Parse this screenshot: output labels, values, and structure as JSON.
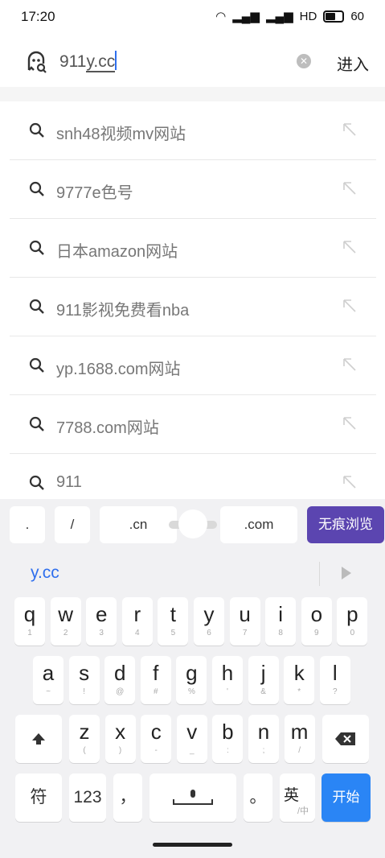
{
  "status_bar": {
    "time": "17:20",
    "network": "HD",
    "battery": "60"
  },
  "search": {
    "text_before": "911",
    "text_underlined": "y.cc",
    "enter_label": "进入"
  },
  "suggestions": [
    {
      "text": "snh48视频mv网站"
    },
    {
      "text": "9777e色号"
    },
    {
      "text": "日本amazon网站"
    },
    {
      "text": "911影视免费看nba"
    },
    {
      "text": "yp.1688.com网站"
    },
    {
      "text": "7788.com网站"
    },
    {
      "text": "911"
    }
  ],
  "quick_row": {
    "dot": ".",
    "slash": "/",
    "cn": ".cn",
    "com": ".com",
    "incognito": "无痕浏览"
  },
  "candidate": {
    "text": "y.cc"
  },
  "keyboard": {
    "row1": [
      {
        "m": "q",
        "s": "1"
      },
      {
        "m": "w",
        "s": "2"
      },
      {
        "m": "e",
        "s": "3"
      },
      {
        "m": "r",
        "s": "4"
      },
      {
        "m": "t",
        "s": "5"
      },
      {
        "m": "y",
        "s": "6"
      },
      {
        "m": "u",
        "s": "7"
      },
      {
        "m": "i",
        "s": "8"
      },
      {
        "m": "o",
        "s": "9"
      },
      {
        "m": "p",
        "s": "0"
      }
    ],
    "row2": [
      {
        "m": "a",
        "s": "~"
      },
      {
        "m": "s",
        "s": "!"
      },
      {
        "m": "d",
        "s": "@"
      },
      {
        "m": "f",
        "s": "#"
      },
      {
        "m": "g",
        "s": "%"
      },
      {
        "m": "h",
        "s": "'"
      },
      {
        "m": "j",
        "s": "&"
      },
      {
        "m": "k",
        "s": "*"
      },
      {
        "m": "l",
        "s": "?"
      }
    ],
    "row3": [
      {
        "m": "z",
        "s": "("
      },
      {
        "m": "x",
        "s": ")"
      },
      {
        "m": "c",
        "s": "-"
      },
      {
        "m": "v",
        "s": "_"
      },
      {
        "m": "b",
        "s": ":"
      },
      {
        "m": "n",
        "s": ";"
      },
      {
        "m": "m",
        "s": "/"
      }
    ],
    "symbols_label": "符",
    "numbers_label": "123",
    "comma_label": "，",
    "period_label": "。",
    "lang_label": "英",
    "lang_sub": "/中",
    "start_label": "开始"
  }
}
